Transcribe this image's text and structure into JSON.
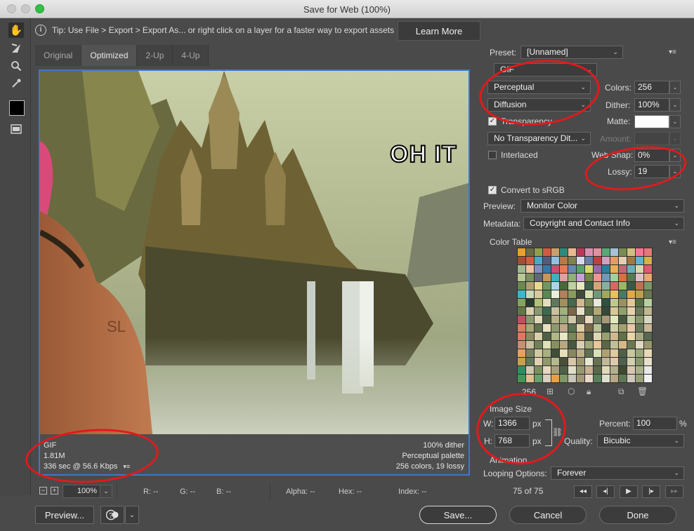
{
  "window": {
    "title": "Save for Web (100%)"
  },
  "tip": {
    "text": "Tip: Use File > Export > Export As...  or right click on a layer for a faster way to export assets",
    "button": "Learn More"
  },
  "tabs": [
    "Original",
    "Optimized",
    "2-Up",
    "4-Up"
  ],
  "active_tab": "Optimized",
  "preview": {
    "overlay_text": "OH IT",
    "info_left": [
      "GIF",
      "1.81M",
      "336 sec @ 56.6 Kbps"
    ],
    "info_right": [
      "100% dither",
      "Perceptual palette",
      "256 colors, 19 lossy"
    ]
  },
  "status": {
    "zoom": "100%",
    "r": "R: --",
    "g": "G: --",
    "b": "B: --",
    "alpha": "Alpha: --",
    "hex": "Hex: --",
    "index": "Index: --"
  },
  "buttons": {
    "preview": "Preview...",
    "save": "Save...",
    "cancel": "Cancel",
    "done": "Done"
  },
  "settings": {
    "preset_label": "Preset:",
    "preset_value": "[Unnamed]",
    "format": "GIF",
    "reduction": "Perceptual",
    "dither_algo": "Diffusion",
    "colors_label": "Colors:",
    "colors_value": "256",
    "dither_label": "Dither:",
    "dither_value": "100%",
    "transparency_label": "Transparency",
    "transparency_checked": true,
    "matte_label": "Matte:",
    "matte_color": "#ffffff",
    "trans_dither": "No Transparency Dit...",
    "amount_label": "Amount:",
    "amount_value": "",
    "interlaced_label": "Interlaced",
    "interlaced_checked": false,
    "websnap_label": "Web Snap:",
    "websnap_value": "0%",
    "lossy_label": "Lossy:",
    "lossy_value": "19",
    "convert_srgb_label": "Convert to sRGB",
    "convert_srgb_checked": true,
    "preview_label": "Preview:",
    "preview_value": "Monitor Color",
    "metadata_label": "Metadata:",
    "metadata_value": "Copyright and Contact Info"
  },
  "color_table": {
    "title": "Color Table",
    "count": "256",
    "colors": [
      "#e8a030",
      "#6b6b45",
      "#8fa04a",
      "#d25a40",
      "#c8a070",
      "#2e8a7a",
      "#e8b890",
      "#b83858",
      "#d890b0",
      "#e090a0",
      "#58a878",
      "#a8c0d8",
      "#7a8a50",
      "#d0c080",
      "#f07898",
      "#e87878",
      "#a05030",
      "#c86040",
      "#4aa8c8",
      "#585878",
      "#90c0e0",
      "#b87848",
      "#808050",
      "#d8d8e8",
      "#6880a8",
      "#c04040",
      "#d0a0c0",
      "#e89a60",
      "#e0d0b8",
      "#a07840",
      "#60b0d0",
      "#d8b048",
      "#a0b890",
      "#f0c0a0",
      "#8090c0",
      "#3878a8",
      "#c85070",
      "#e87858",
      "#6888b0",
      "#58a068",
      "#d8d870",
      "#9868a8",
      "#2880a0",
      "#e8b050",
      "#c06878",
      "#6ab0b8",
      "#d8d8b0",
      "#e05870",
      "#b8c890",
      "#7a9060",
      "#606878",
      "#c89858",
      "#40b0c0",
      "#e0a0a0",
      "#90b078",
      "#c8a0d8",
      "#708840",
      "#e89890",
      "#7098b8",
      "#a0d0a0",
      "#d87040",
      "#5a7850",
      "#e0c0c8",
      "#e8a870",
      "#6a8850",
      "#b0a070",
      "#e8d890",
      "#709860",
      "#a8d8e8",
      "#4a6838",
      "#c0d0a0",
      "#e8e8c0",
      "#406048",
      "#d0a878",
      "#88b0a0",
      "#d86868",
      "#98b868",
      "#3a5a48",
      "#c07050",
      "#7a9868",
      "#38b8c8",
      "#c8d8b8",
      "#d8c8a0",
      "#5a8858",
      "#e8f0d8",
      "#b08060",
      "#8a9a60",
      "#404a38",
      "#d8e0b0",
      "#709878",
      "#a0a860",
      "#e8c060",
      "#4a7868",
      "#e0a848",
      "#b8a050",
      "#6a7850",
      "#8aa060",
      "#2a3a30",
      "#b0c078",
      "#e0e0c0",
      "#607860",
      "#a09060",
      "#486850",
      "#d0b890",
      "#7a8a58",
      "#e8e8d8",
      "#305040",
      "#c0c890",
      "#9a9068",
      "#e0c8a0",
      "#587048",
      "#b8d0a0",
      "#607848",
      "#d8d0b0",
      "#889870",
      "#406850",
      "#c8c0a0",
      "#a0b080",
      "#7a6848",
      "#e8e0c8",
      "#5a6a48",
      "#b0a878",
      "#384838",
      "#d8c898",
      "#90a070",
      "#e8d0b0",
      "#6a7a58",
      "#c0b890",
      "#c05060",
      "#8a9a70",
      "#e0d8b8",
      "#4a5a40",
      "#b8b088",
      "#98a878",
      "#d0c8a8",
      "#6a6850",
      "#e8d8c0",
      "#708060",
      "#a89878",
      "#e0e8c0",
      "#485840",
      "#c8d0a8",
      "#88986a",
      "#d8d8c0",
      "#d88060",
      "#a8a878",
      "#607050",
      "#e8e0c0",
      "#909a70",
      "#c0a888",
      "#5a7050",
      "#e0d0a8",
      "#786848",
      "#b8c098",
      "#3a4838",
      "#d0d0a8",
      "#a0a070",
      "#e8c8a8",
      "#687858",
      "#c8b898",
      "#e07860",
      "#8a8a60",
      "#d8d0a8",
      "#506048",
      "#b0b888",
      "#e8e8c8",
      "#788858",
      "#c8a878",
      "#4a5840",
      "#e0d8b0",
      "#98a070",
      "#d0b890",
      "#607048",
      "#e8d8a8",
      "#a8a880",
      "#586850",
      "#c89070",
      "#c8c0a0",
      "#708058",
      "#e0e0b8",
      "#889060",
      "#b8a880",
      "#485840",
      "#d8d0b0",
      "#a0a878",
      "#e8c898",
      "#5a6848",
      "#c0c098",
      "#d8b888",
      "#6a7850",
      "#e0d8c0",
      "#98986a",
      "#e8a060",
      "#788060",
      "#d0c8a0",
      "#a8b080",
      "#405038",
      "#e8e0b8",
      "#888860",
      "#c0b088",
      "#607050",
      "#d8e0b8",
      "#b0a070",
      "#e0c8a0",
      "#506048",
      "#c8c8a0",
      "#98a878",
      "#e8d8b8",
      "#c8a050",
      "#607858",
      "#e0d0b0",
      "#90986a",
      "#b8b890",
      "#485038",
      "#d8c8a8",
      "#a09870",
      "#e8e8d0",
      "#687050",
      "#c0b898",
      "#e0c8b0",
      "#506050",
      "#d0d0b0",
      "#889868",
      "#e8e0c8",
      "#2a9060",
      "#d0c8b0",
      "#789060",
      "#e8d8c0",
      "#a8a078",
      "#506048",
      "#e0e0c8",
      "#989870",
      "#c8b090",
      "#586848",
      "#e0d8b8",
      "#b0b090",
      "#404830",
      "#d8c8b0",
      "#a8b088",
      "#e8e8e8",
      "#409858",
      "#e0c090",
      "#68a070",
      "#d8d0c0",
      "#e8a048",
      "#809868",
      "#c8c8b8",
      "#a09878",
      "#e8d8c8",
      "#588058",
      "#e0e0d0",
      "#b8a888",
      "#607858",
      "#d0c8c0",
      "#98a078",
      "#f0f0f0"
    ]
  },
  "image_size": {
    "title": "Image Size",
    "w_label": "W:",
    "w_value": "1366",
    "h_label": "H:",
    "h_value": "768",
    "unit": "px",
    "percent_label": "Percent:",
    "percent_value": "100",
    "percent_unit": "%",
    "quality_label": "Quality:",
    "quality_value": "Bicubic"
  },
  "animation": {
    "title": "Animation",
    "looping_label": "Looping Options:",
    "looping_value": "Forever",
    "frame_counter": "75 of 75"
  }
}
